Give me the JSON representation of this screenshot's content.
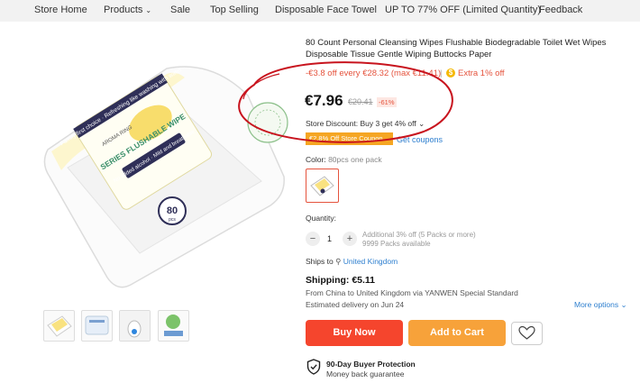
{
  "nav": {
    "items": [
      "Store Home",
      "Products",
      "Sale",
      "Top Selling",
      "Disposable Face Towel",
      "UP TO 77% OFF (Limited Quantity)",
      "Feedback"
    ]
  },
  "product": {
    "title": "80 Count Personal Cleansing Wipes Flushable Biodegradable Toilet Wet Wipes Disposable Tissue Gentle Wiping Buttocks Paper",
    "promo": "-€3.8 off every €28.32 (max €11.41)",
    "promo_sep": "|",
    "extra": "Extra 1% off",
    "extra_icon": "$",
    "price": "€7.96",
    "original_price": "€20.41",
    "discount": "-61%",
    "store_discount": "Store Discount: Buy 3 get 4% off",
    "coupon_badge": "€2.8% Off Store Coupon",
    "get_coupons": "Get coupons",
    "color_label": "Color:",
    "color_value": "80pcs one pack",
    "quantity_label": "Quantity:",
    "quantity": "1",
    "qty_minus": "−",
    "qty_plus": "+",
    "qty_note": "Additional 3% off (5 Packs or more)",
    "stock": "9999 Packs available",
    "ships_to_label": "Ships to",
    "ships_to": "United Kingdom",
    "shipping": "Shipping: €5.11",
    "from_text": "From China to United Kingdom via YANWEN Special Standard",
    "delivery": "Estimated delivery on Jun 24",
    "more_options": "More options",
    "buy_now": "Buy Now",
    "add_to_cart": "Add to Cart",
    "protection_title": "90-Day Buyer Protection",
    "protection_sub": "Money back guarantee"
  },
  "package": {
    "count": "80",
    "unit": "pcs",
    "brand": "AROMA RING",
    "series": "SERIES FLUSHABLE WIPE",
    "band": "Family first choice · Refreshing like washing with water",
    "tag": "No added alcohol · Mild and breathable"
  },
  "colors": {
    "accent": "#f5452d",
    "cart": "#f7a23a",
    "link": "#2e7fcf",
    "annotation": "#c8141e"
  }
}
